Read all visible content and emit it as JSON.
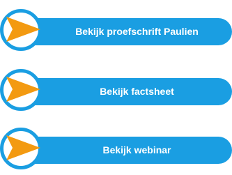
{
  "buttons": [
    {
      "label": "Bekijk proefschrift Paulien",
      "icon": "arrow-right-icon"
    },
    {
      "label": "Bekijk factsheet",
      "icon": "arrow-right-icon"
    },
    {
      "label": "Bekijk webinar",
      "icon": "arrow-right-icon"
    }
  ],
  "colors": {
    "accent": "#1a9ee2",
    "arrow": "#f39a11",
    "label_text": "#ffffff"
  }
}
